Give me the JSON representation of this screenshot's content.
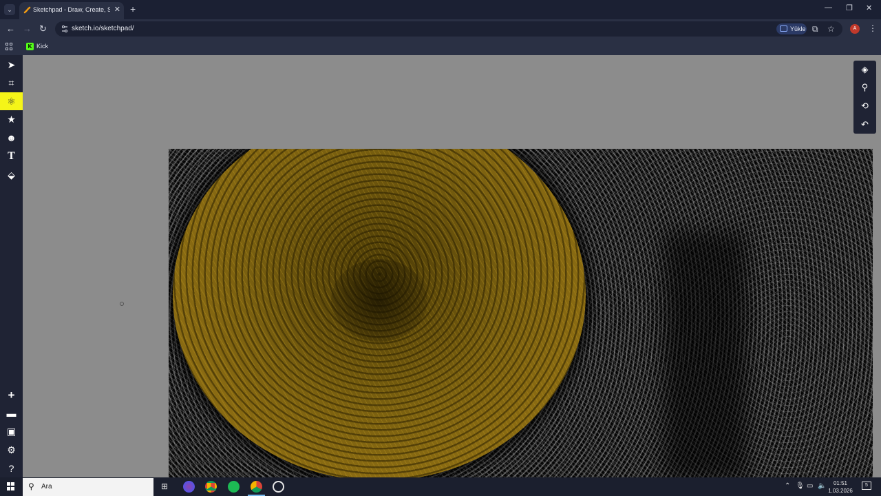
{
  "browser": {
    "tab_title": "Sketchpad - Draw, Create, Share!",
    "url": "sketch.io/sketchpad/",
    "upgrade_label": "Yükle",
    "avatar_letter": "A",
    "bookmark_label": "Kick",
    "accent": "#2a3044"
  },
  "app": {
    "left_tools": [
      "select-arrow-icon",
      "crop-icon",
      "atom-icon",
      "star-icon",
      "sticker-icon",
      "text-icon",
      "paint-bucket-icon",
      "plus-icon",
      "folder-icon",
      "save-icon",
      "settings-icon",
      "help-icon"
    ],
    "active_tool": "atom-icon",
    "active_color": "#f5f518",
    "right_tools": [
      "layers-icon",
      "zoom-icon",
      "history-icon",
      "undo-icon"
    ]
  },
  "taskbar": {
    "search_placeholder": "Ara",
    "time": "01:51",
    "date": "1.03.2026",
    "notification_count": "5"
  }
}
